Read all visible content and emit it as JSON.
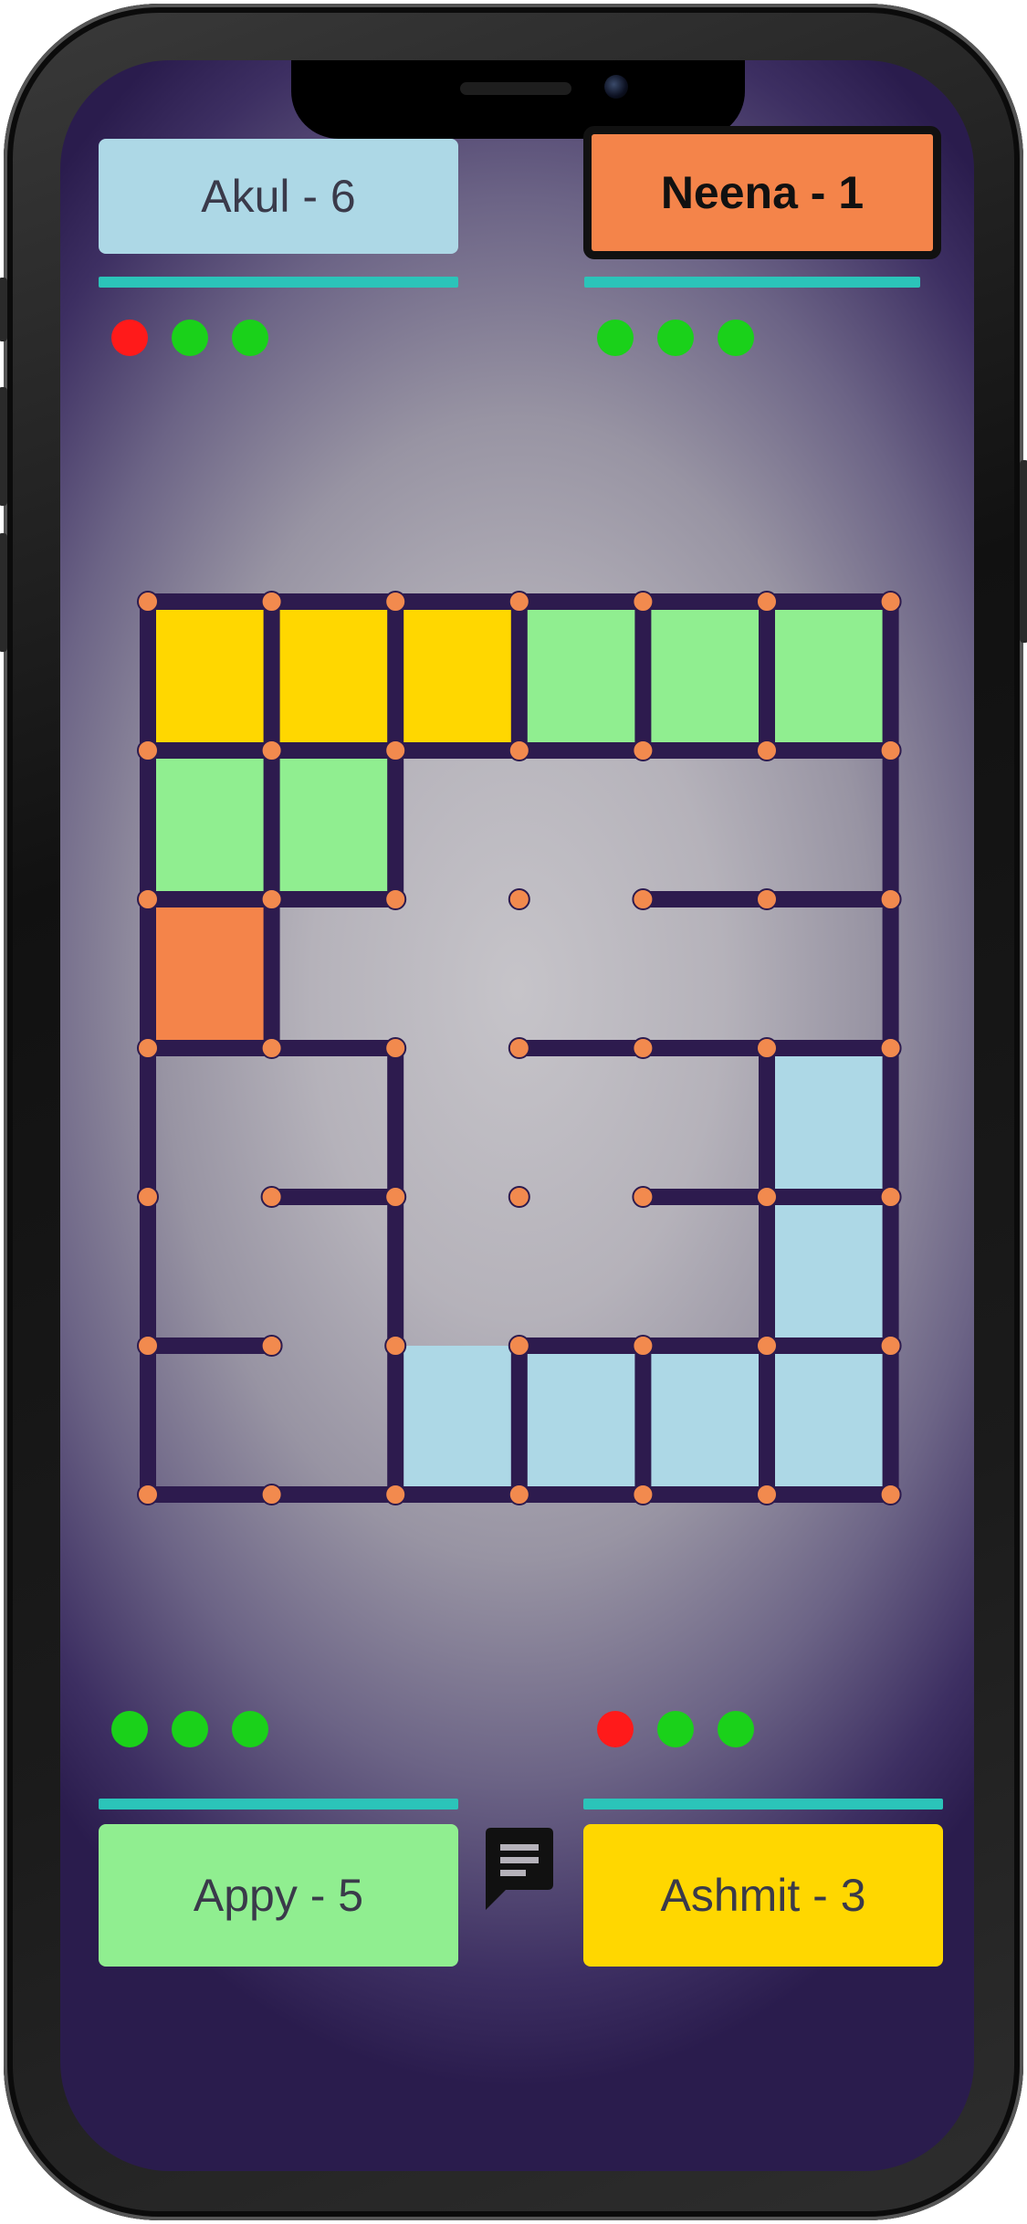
{
  "colors": {
    "accent_bar": "#2bc4b9",
    "line": "#2d1b4e",
    "node": "#f28a4e",
    "life_lost": "#ff1a1a",
    "life_left": "#1ad11a"
  },
  "players": [
    {
      "id": "top-left",
      "label": "Akul - 6",
      "color": "#add8e6",
      "active": false,
      "lives": [
        "lost",
        "left",
        "left"
      ]
    },
    {
      "id": "top-right",
      "label": "Neena - 1",
      "color": "#f4844a",
      "active": true,
      "lives": [
        "left",
        "left",
        "left"
      ]
    },
    {
      "id": "bottom-left",
      "label": "Appy - 5",
      "color": "#90ee90",
      "active": false,
      "lives": [
        "left",
        "left",
        "left"
      ]
    },
    {
      "id": "bottom-right",
      "label": "Ashmit - 3",
      "color": "#ffd700",
      "active": false,
      "lives": [
        "lost",
        "left",
        "left"
      ]
    }
  ],
  "chat_icon": "message-icon",
  "board": {
    "cols": 6,
    "rows": 6,
    "filled_boxes": [
      {
        "row": 0,
        "col": 0,
        "owner": "Ashmit"
      },
      {
        "row": 0,
        "col": 1,
        "owner": "Ashmit"
      },
      {
        "row": 0,
        "col": 2,
        "owner": "Ashmit"
      },
      {
        "row": 0,
        "col": 3,
        "owner": "Appy"
      },
      {
        "row": 0,
        "col": 4,
        "owner": "Appy"
      },
      {
        "row": 0,
        "col": 5,
        "owner": "Appy"
      },
      {
        "row": 1,
        "col": 0,
        "owner": "Appy"
      },
      {
        "row": 1,
        "col": 1,
        "owner": "Appy"
      },
      {
        "row": 2,
        "col": 0,
        "owner": "Neena"
      },
      {
        "row": 3,
        "col": 5,
        "owner": "Akul"
      },
      {
        "row": 4,
        "col": 5,
        "owner": "Akul"
      },
      {
        "row": 5,
        "col": 2,
        "owner": "Akul"
      },
      {
        "row": 5,
        "col": 3,
        "owner": "Akul"
      },
      {
        "row": 5,
        "col": 4,
        "owner": "Akul"
      },
      {
        "row": 5,
        "col": 5,
        "owner": "Akul"
      }
    ],
    "h_lines": [
      [
        0,
        0
      ],
      [
        0,
        1
      ],
      [
        0,
        2
      ],
      [
        0,
        3
      ],
      [
        0,
        4
      ],
      [
        0,
        5
      ],
      [
        1,
        0
      ],
      [
        1,
        1
      ],
      [
        1,
        2
      ],
      [
        1,
        3
      ],
      [
        1,
        4
      ],
      [
        1,
        5
      ],
      [
        2,
        0
      ],
      [
        2,
        1
      ],
      [
        2,
        4
      ],
      [
        2,
        5
      ],
      [
        3,
        0
      ],
      [
        3,
        1
      ],
      [
        3,
        3
      ],
      [
        3,
        4
      ],
      [
        3,
        5
      ],
      [
        4,
        1
      ],
      [
        4,
        4
      ],
      [
        4,
        5
      ],
      [
        5,
        0
      ],
      [
        5,
        3
      ],
      [
        5,
        4
      ],
      [
        5,
        5
      ],
      [
        6,
        0
      ],
      [
        6,
        1
      ],
      [
        6,
        2
      ],
      [
        6,
        3
      ],
      [
        6,
        4
      ],
      [
        6,
        5
      ]
    ],
    "v_lines": [
      [
        0,
        0
      ],
      [
        0,
        1
      ],
      [
        0,
        2
      ],
      [
        0,
        3
      ],
      [
        0,
        4
      ],
      [
        0,
        5
      ],
      [
        0,
        6
      ],
      [
        1,
        0
      ],
      [
        1,
        1
      ],
      [
        1,
        2
      ],
      [
        1,
        6
      ],
      [
        2,
        0
      ],
      [
        2,
        1
      ],
      [
        2,
        6
      ],
      [
        3,
        0
      ],
      [
        3,
        2
      ],
      [
        3,
        5
      ],
      [
        3,
        6
      ],
      [
        4,
        0
      ],
      [
        4,
        2
      ],
      [
        4,
        5
      ],
      [
        4,
        6
      ],
      [
        5,
        0
      ],
      [
        5,
        2
      ],
      [
        5,
        3
      ],
      [
        5,
        4
      ],
      [
        5,
        5
      ],
      [
        5,
        6
      ]
    ]
  }
}
